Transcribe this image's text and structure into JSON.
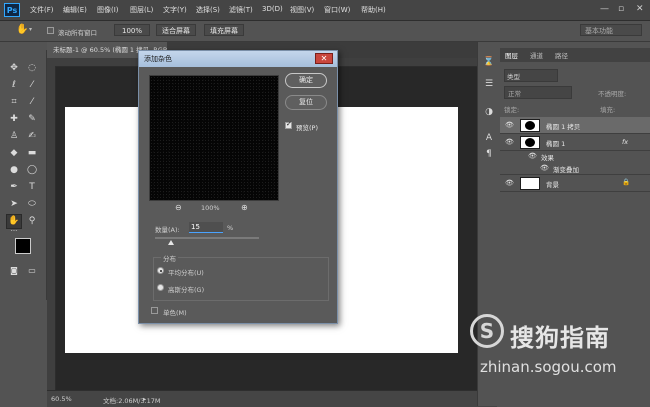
{
  "app": {
    "logo_text": "Ps"
  },
  "menu": [
    "文件(F)",
    "编辑(E)",
    "图像(I)",
    "图层(L)",
    "文字(Y)",
    "选择(S)",
    "滤镜(T)",
    "3D(D)",
    "视图(V)",
    "窗口(W)",
    "帮助(H)"
  ],
  "window_controls": {
    "minimize": "—",
    "restore": "▫",
    "close": "✕"
  },
  "options_bar": {
    "scroll_all_label": "滚动所有窗口",
    "zoom_100": "100%",
    "fit_screen": "适合屏幕",
    "fill_screen": "填充屏幕",
    "workspace": "基本功能"
  },
  "document": {
    "tab_title": "未标题-1 @ 60.5% (椭圆 1 拷贝, RGB/8) *",
    "status_zoom": "60.5%",
    "status_doc": "文档:2.06M/3.17M"
  },
  "dialog": {
    "title": "添加杂色",
    "ok": "确定",
    "reset": "复位",
    "preview_label": "预览(P)",
    "zoom_level": "100%",
    "amount_label": "数量(A):",
    "amount_value": "15",
    "amount_unit": "%",
    "amount_percent": 15,
    "distribution_label": "分布",
    "uniform": "平均分布(U)",
    "gaussian": "高斯分布(G)",
    "monochrome": "单色(M)"
  },
  "layers_panel": {
    "tabs": [
      "图层",
      "通道",
      "路径"
    ],
    "search_placeholder": "类型",
    "blend_mode": "正常",
    "opacity_label": "不透明度:",
    "lock_label": "锁定:",
    "fill_label": "填充:",
    "layers": [
      {
        "name": "椭圆 1 拷贝"
      },
      {
        "name": "椭圆 1",
        "fx": "fx"
      },
      {
        "name": "效果"
      },
      {
        "name": "渐变叠加"
      },
      {
        "name": "背景"
      }
    ]
  },
  "watermark": {
    "brand_icon": "S",
    "cn": "搜狗指南",
    "url": "zhinan.sogou.com"
  }
}
